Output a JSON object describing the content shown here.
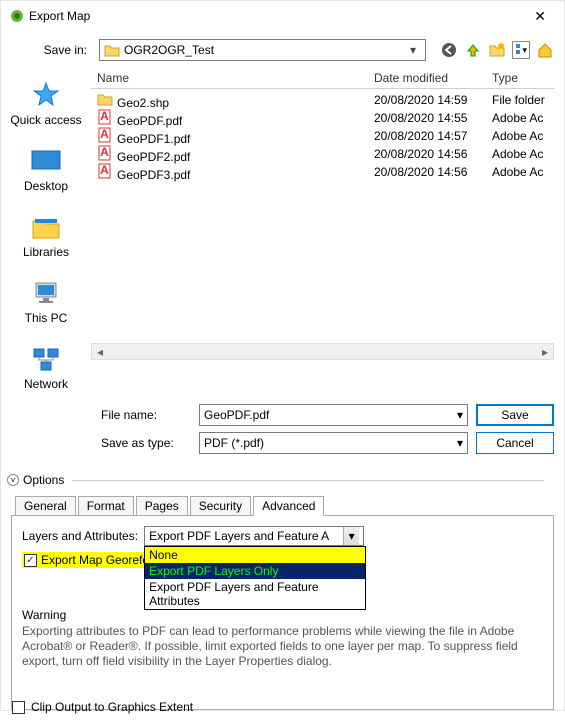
{
  "window": {
    "title": "Export Map"
  },
  "savein": {
    "label": "Save in:",
    "folder": "OGR2OGR_Test"
  },
  "columns": {
    "name": "Name",
    "date": "Date modified",
    "type": "Type"
  },
  "files": [
    {
      "icon": "folder",
      "name": "Geo2.shp",
      "date": "20/08/2020 14:59",
      "type": "File folder"
    },
    {
      "icon": "pdf",
      "name": "GeoPDF.pdf",
      "date": "20/08/2020 14:55",
      "type": "Adobe Ac"
    },
    {
      "icon": "pdf",
      "name": "GeoPDF1.pdf",
      "date": "20/08/2020 14:57",
      "type": "Adobe Ac"
    },
    {
      "icon": "pdf",
      "name": "GeoPDF2.pdf",
      "date": "20/08/2020 14:56",
      "type": "Adobe Ac"
    },
    {
      "icon": "pdf",
      "name": "GeoPDF3.pdf",
      "date": "20/08/2020 14:56",
      "type": "Adobe Ac"
    }
  ],
  "places": [
    {
      "label": "Quick access"
    },
    {
      "label": "Desktop"
    },
    {
      "label": "Libraries"
    },
    {
      "label": "This PC"
    },
    {
      "label": "Network"
    }
  ],
  "form": {
    "filename_label": "File name:",
    "filename_value": "GeoPDF.pdf",
    "saveastype_label": "Save as type:",
    "saveastype_value": "PDF (*.pdf)",
    "save_btn": "Save",
    "cancel_btn": "Cancel"
  },
  "options": {
    "header": "Options",
    "tabs": [
      "General",
      "Format",
      "Pages",
      "Security",
      "Advanced"
    ],
    "active_tab": 4,
    "layers_attrs_label": "Layers and Attributes:",
    "layers_attrs_value": "Export PDF Layers and Feature Attributes",
    "layers_attrs_options": [
      "None",
      "Export PDF Layers Only",
      "Export PDF Layers and Feature Attributes"
    ],
    "export_georef_label": "Export Map Georefere",
    "warning_label": "Warning",
    "warning_text": "Exporting attributes to PDF can lead to performance problems while viewing the file in Adobe Acrobat® or Reader®.  If possible, limit exported fields to one layer per map.  To suppress field export, turn off field visibility in the Layer Properties dialog."
  },
  "clip_label": "Clip Output to Graphics Extent"
}
